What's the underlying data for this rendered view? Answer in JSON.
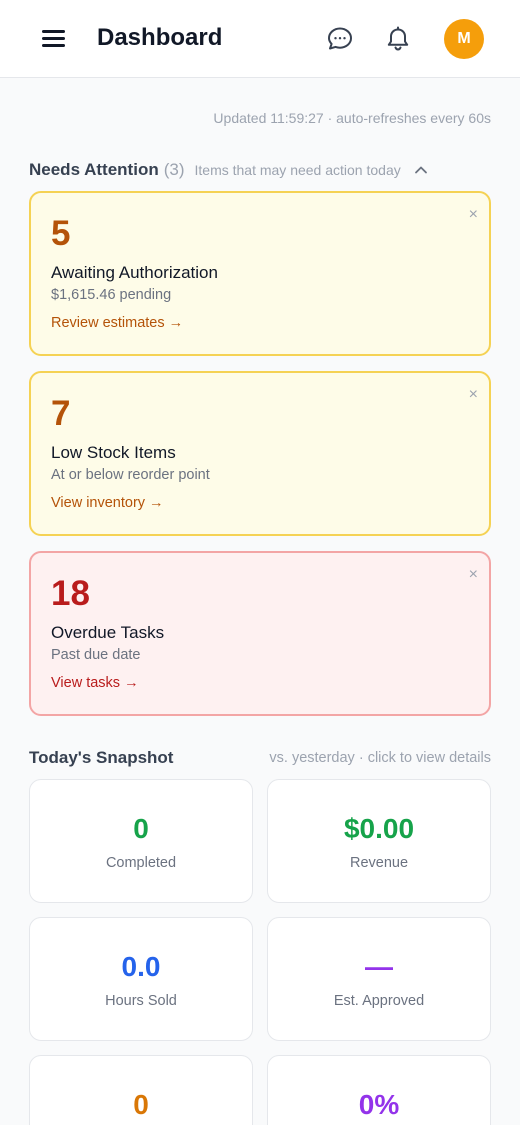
{
  "header": {
    "title": "Dashboard",
    "avatar_initial": "M",
    "icons": [
      "menu-icon",
      "chat-icon",
      "bell-icon"
    ]
  },
  "updated_text": "Updated 11:59:27 · auto-refreshes every 60s",
  "attention": {
    "title": "Needs Attention",
    "count": "(3)",
    "subtitle": "Items that may need action today",
    "items": [
      {
        "value": "5",
        "label": "Awaiting Authorization",
        "detail": "$1,615.46 pending",
        "link": "Review estimates →",
        "tone": "warning"
      },
      {
        "value": "7",
        "label": "Low Stock Items",
        "detail": "At or below reorder point",
        "link": "View inventory →",
        "tone": "warning"
      },
      {
        "value": "18",
        "label": "Overdue Tasks",
        "detail": "Past due date",
        "link": "View tasks →",
        "tone": "danger"
      }
    ],
    "close_glyph": "×"
  },
  "snapshot": {
    "title": "Today's Snapshot",
    "subtitle": "vs. yesterday · click to view details",
    "tiles": [
      {
        "value": "0",
        "caption": "Completed",
        "color": "#16a34a"
      },
      {
        "value": "$0.00",
        "caption": "Revenue",
        "color": "#16a34a"
      },
      {
        "value": "0.0",
        "caption": "Hours Sold",
        "color": "#2563eb"
      },
      {
        "value": "—",
        "caption": "Est. Approved",
        "color": "#9333ea"
      },
      {
        "value": "0",
        "caption": "",
        "color": "#d97706"
      },
      {
        "value": "0%",
        "caption": "",
        "color": "#9333ea"
      }
    ]
  },
  "colors": {
    "accent": "#f59e0b",
    "warning": "#b45309",
    "danger": "#b91c1c"
  }
}
